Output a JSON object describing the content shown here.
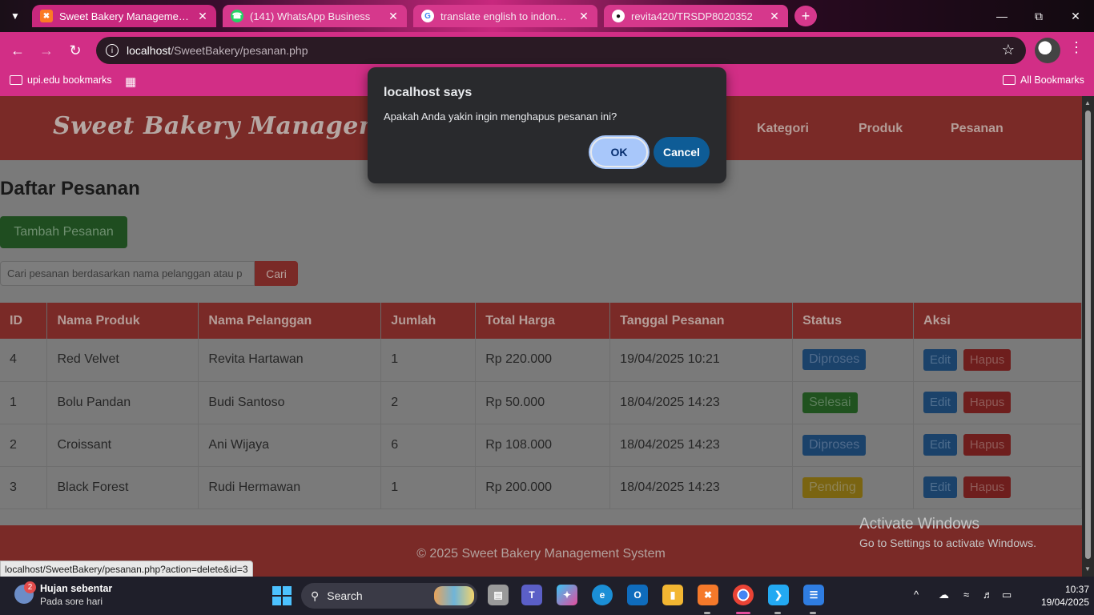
{
  "browser": {
    "tabs": [
      {
        "title": "Sweet Bakery Management Syst",
        "favicon": "xampp-icon",
        "active": true
      },
      {
        "title": "(141) WhatsApp Business",
        "favicon": "whatsapp-icon",
        "active": false
      },
      {
        "title": "translate english to indonesia",
        "favicon": "google-icon",
        "active": false
      },
      {
        "title": "revita420/TRSDP8020352",
        "favicon": "github-icon",
        "active": false
      }
    ],
    "url_host": "localhost",
    "url_path": "/SweetBakery/pesanan.php",
    "bookmarks_left": "upi.edu bookmarks",
    "bookmarks_right": "All Bookmarks",
    "status_url": "localhost/SweetBakery/pesanan.php?action=delete&id=3"
  },
  "site": {
    "brand": "Sweet Bakery Management System",
    "nav": [
      "Kategori",
      "Produk",
      "Pesanan"
    ],
    "page_title": "Daftar Pesanan",
    "add_button": "Tambah Pesanan",
    "search_placeholder": "Cari pesanan berdasarkan nama pelanggan atau p",
    "search_button": "Cari",
    "table": {
      "headers": [
        "ID",
        "Nama Produk",
        "Nama Pelanggan",
        "Jumlah",
        "Total Harga",
        "Tanggal Pesanan",
        "Status",
        "Aksi"
      ],
      "rows": [
        {
          "id": "4",
          "produk": "Red Velvet",
          "pelanggan": "Revita Hartawan",
          "jumlah": "1",
          "total": "Rp 220.000",
          "tanggal": "19/04/2025 10:21",
          "status": "Diproses",
          "status_color": "#1b426a"
        },
        {
          "id": "1",
          "produk": "Bolu Pandan",
          "pelanggan": "Budi Santoso",
          "jumlah": "2",
          "total": "Rp 50.000",
          "tanggal": "18/04/2025 14:23",
          "status": "Selesai",
          "status_color": "#20521f"
        },
        {
          "id": "2",
          "produk": "Croissant",
          "pelanggan": "Ani Wijaya",
          "jumlah": "6",
          "total": "Rp 108.000",
          "tanggal": "18/04/2025 14:23",
          "status": "Diproses",
          "status_color": "#1b426a"
        },
        {
          "id": "3",
          "produk": "Black Forest",
          "pelanggan": "Rudi Hermawan",
          "jumlah": "1",
          "total": "Rp 200.000",
          "tanggal": "18/04/2025 14:23",
          "status": "Pending",
          "status_color": "#7a6411"
        }
      ],
      "edit_label": "Edit",
      "delete_label": "Hapus"
    },
    "footer": "© 2025 Sweet Bakery Management System"
  },
  "dialog": {
    "title": "localhost says",
    "message": "Apakah Anda yakin ingin menghapus pesanan ini?",
    "ok": "OK",
    "cancel": "Cancel"
  },
  "watermark": {
    "line1": "Activate Windows",
    "line2": "Go to Settings to activate Windows."
  },
  "taskbar": {
    "weather_title": "Hujan sebentar",
    "weather_sub": "Pada sore hari",
    "weather_badge": "2",
    "search_label": "Search",
    "time": "10:37",
    "date": "19/04/2025"
  }
}
